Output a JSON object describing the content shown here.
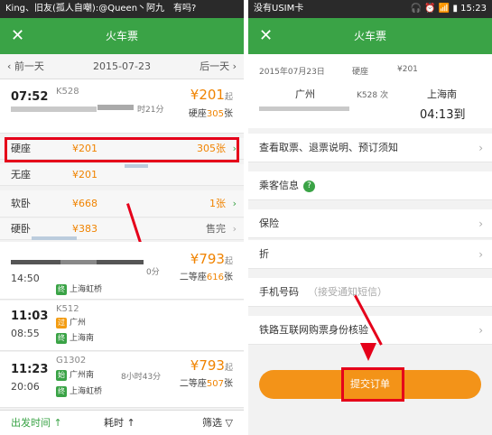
{
  "left": {
    "statusbar": {
      "text": "King、旧友(孤人自嘲):@Queen丶阿九　有吗?"
    },
    "titlebar": {
      "title": "火车票",
      "close": "✕"
    },
    "datebar": {
      "prev": "前一天",
      "date": "2015-07-23",
      "next": "后一天"
    },
    "train1": {
      "depart": "07:52",
      "no": "K528",
      "duration": "时21分",
      "price": "¥201",
      "price_suffix": "起",
      "seat_label": "硬座",
      "seat_count": "305",
      "seat_unit": "张"
    },
    "seats": [
      {
        "name": "硬座",
        "price": "¥201",
        "count": "305张"
      },
      {
        "name": "无座",
        "price": "¥201",
        "count": ""
      },
      {
        "name": "软卧",
        "price": "¥668",
        "count": "1张"
      },
      {
        "name": "硬卧",
        "price": "¥383",
        "count": "售完"
      }
    ],
    "train2": {
      "arrive": "14:50",
      "duration": "0分",
      "station_tag": "终",
      "station": "上海虹桥",
      "price": "¥793",
      "price_suffix": "起",
      "seat_label": "二等座",
      "seat_count": "616",
      "seat_unit": "张"
    },
    "train3": {
      "depart": "11:03",
      "arrive": "08:55",
      "no": "K512",
      "from_tag": "过",
      "from": "广州",
      "to_tag": "终",
      "to": "上海南"
    },
    "train4": {
      "depart": "11:23",
      "arrive": "20:06",
      "no": "G1302",
      "from_tag": "始",
      "from": "广州南",
      "to_tag": "终",
      "to": "上海虹桥",
      "duration": "8小时43分",
      "price": "¥793",
      "price_suffix": "起",
      "seat_label": "二等座",
      "seat_count": "507",
      "seat_unit": "张"
    },
    "bottombar": {
      "depart_time": "出发时间 ↑",
      "duration": "耗时 ↑",
      "filter": "筛选"
    }
  },
  "right": {
    "statusbar": {
      "text": "没有USIM卡",
      "time": "15:23"
    },
    "titlebar": {
      "title": "火车票",
      "close": "✕"
    },
    "ticket": {
      "date": "2015年07月23日",
      "seat": "硬座",
      "price": "¥201",
      "from": "广州",
      "train_no": "K528 次",
      "to": "上海南",
      "arrive": "04:13到"
    },
    "rows": {
      "info": "查看取票、退票说明、预订须知",
      "passenger": "乘客信息",
      "help_icon": "?",
      "insurance": "保险",
      "invoice": "折",
      "phone_label": "手机号码",
      "phone_placeholder": "（接受通知短信）",
      "verify": "铁路互联网购票身份核验"
    },
    "submit": "提交订单"
  },
  "colors": {
    "brand_green": "#3aa346",
    "accent_orange": "#f08300",
    "highlight_red": "#e5001a",
    "submit_orange": "#f39318"
  }
}
